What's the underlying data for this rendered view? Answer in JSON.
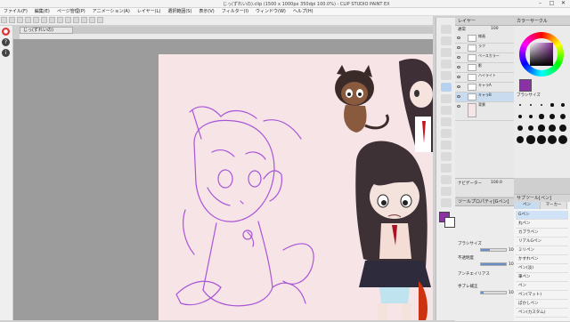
{
  "app": {
    "title": "じっ(ずれいの).clip (1500 x 1000px 350dpi 100.0%)  -  CLIP STUDIO PAINT EX",
    "window_controls": [
      "–",
      "□",
      "✕"
    ]
  },
  "menu": [
    "ファイル(F)",
    "編集(E)",
    "ページ管理(P)",
    "アニメーション(A)",
    "レイヤー(L)",
    "選択範囲(S)",
    "表示(V)",
    "フィルター(I)",
    "ウィンドウ(W)",
    "ヘルプ(H)"
  ],
  "document": {
    "tab_label": "じっ(ずれいの)"
  },
  "layers_panel": {
    "title": "レイヤー",
    "blend_mode": "通常",
    "opacity": "100",
    "layers": [
      "線画",
      "ラフ",
      "ベースカラー",
      "影",
      "ハイライト",
      "キャラA",
      "キャラB",
      "背景"
    ]
  },
  "color_panel": {
    "title": "カラーサークル",
    "current_color": "#8b32a4",
    "sizes_label": "ブラシサイズ",
    "size_values": [
      "1",
      "2",
      "3",
      "4",
      "5",
      "6",
      "7",
      "8",
      "10",
      "12",
      "15",
      "17",
      "20",
      "25",
      "30",
      "40",
      "50",
      "60",
      "70",
      "80"
    ]
  },
  "navigator": {
    "title": "ナビゲーター",
    "zoom": "100.0"
  },
  "tool_property": {
    "title": "ツールプロパティ[Gペン]",
    "brush_size_label": "ブラシサイズ",
    "brush_size_value": "10.0",
    "brush_size_level": 0.35,
    "opacity_label": "不透明度",
    "opacity_value": "100",
    "opacity_level": 1.0,
    "antialias_label": "アンチエイリアス",
    "stabilize_label": "手ブレ補正",
    "stabilize_value": "10",
    "stabilize_level": 0.1
  },
  "subtool": {
    "title": "サブツール[ペン]",
    "tabs": [
      "ペン",
      "マーカー"
    ],
    "brushes": [
      "Gペン",
      "丸ペン",
      "カブラペン",
      "リアルGペン",
      "ミリペン",
      "かすれペン",
      "ペン(淡)",
      "筆ペン",
      "ペン",
      "ペン(マット)",
      "ぼかしペン",
      "ペン(カスタム)"
    ]
  },
  "canvas": {
    "paper_color": "#f7e4e7",
    "sketch_color": "#a855d8"
  }
}
